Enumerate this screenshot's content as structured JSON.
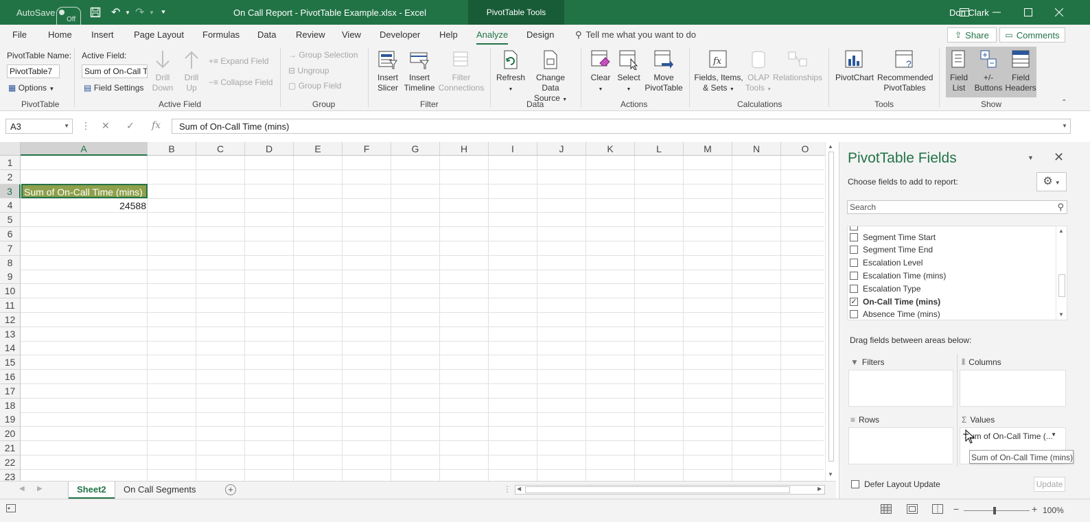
{
  "titlebar": {
    "autosave_label": "AutoSave",
    "autosave_state": "Off",
    "title": "On Call Report - PivotTable Example.xlsx  -  Excel",
    "context_tab": "PivotTable Tools",
    "user": "Don Clark",
    "accent_color": "#217346"
  },
  "menu": {
    "items": [
      "File",
      "Home",
      "Insert",
      "Page Layout",
      "Formulas",
      "Data",
      "Review",
      "View",
      "Developer",
      "Help",
      "Analyze",
      "Design"
    ],
    "active": "Analyze",
    "tell_me": "Tell me what you want to do",
    "share": "Share",
    "comments": "Comments"
  },
  "ribbon": {
    "pivottable": {
      "name_label": "PivotTable Name:",
      "name_value": "PivotTable7",
      "options": "Options",
      "group": "PivotTable"
    },
    "active_field": {
      "label": "Active Field:",
      "value": "Sum of On-Call T",
      "settings": "Field Settings",
      "drill_down_1": "Drill",
      "drill_down_2": "Down",
      "drill_up_1": "Drill",
      "drill_up_2": "Up",
      "expand": "Expand Field",
      "collapse": "Collapse Field",
      "group": "Active Field"
    },
    "group": {
      "selection": "Group Selection",
      "ungroup": "Ungroup",
      "field": "Group Field",
      "group": "Group"
    },
    "filter": {
      "slicer_1": "Insert",
      "slicer_2": "Slicer",
      "timeline_1": "Insert",
      "timeline_2": "Timeline",
      "connections_1": "Filter",
      "connections_2": "Connections",
      "group": "Filter"
    },
    "data": {
      "refresh": "Refresh",
      "change_1": "Change Data",
      "change_2": "Source",
      "group": "Data"
    },
    "actions": {
      "clear": "Clear",
      "select": "Select",
      "move_1": "Move",
      "move_2": "PivotTable",
      "group": "Actions"
    },
    "calculations": {
      "fields_1": "Fields, Items,",
      "fields_2": "& Sets",
      "olap_1": "OLAP",
      "olap_2": "Tools",
      "relationships": "Relationships",
      "group": "Calculations"
    },
    "tools": {
      "pivotchart": "PivotChart",
      "recommended_1": "Recommended",
      "recommended_2": "PivotTables",
      "group": "Tools"
    },
    "show": {
      "fieldlist_1": "Field",
      "fieldlist_2": "List",
      "buttons_1": "+/-",
      "buttons_2": "Buttons",
      "headers_1": "Field",
      "headers_2": "Headers",
      "group": "Show"
    }
  },
  "formula_bar": {
    "name_box": "A3",
    "formula": "Sum of On-Call Time (mins)"
  },
  "grid": {
    "columns": [
      "A",
      "B",
      "C",
      "D",
      "E",
      "F",
      "G",
      "H",
      "I",
      "J",
      "K",
      "L",
      "M",
      "N",
      "O"
    ],
    "rows": [
      "1",
      "2",
      "3",
      "4",
      "5",
      "6",
      "7",
      "8",
      "9",
      "10",
      "11",
      "12",
      "13",
      "14",
      "15",
      "16",
      "17",
      "18",
      "19",
      "20",
      "21",
      "22",
      "23"
    ],
    "a3": "Sum of On-Call Time (mins)",
    "a4": "24588"
  },
  "sheets": {
    "tabs": [
      "Sheet2",
      "On Call Segments"
    ],
    "active": "Sheet2"
  },
  "status": {
    "zoom": "100%"
  },
  "pivot_panel": {
    "title": "PivotTable Fields",
    "subtitle": "Choose fields to add to report:",
    "search_placeholder": "Search",
    "fields": [
      {
        "label": "Segment Time Start",
        "checked": false
      },
      {
        "label": "Segment Time End",
        "checked": false
      },
      {
        "label": "Escalation Level",
        "checked": false
      },
      {
        "label": "Escalation Time (mins)",
        "checked": false
      },
      {
        "label": "Escalation Type",
        "checked": false
      },
      {
        "label": "On-Call Time (mins)",
        "checked": true
      },
      {
        "label": "Absence Time (mins)",
        "checked": false
      }
    ],
    "drag_hint": "Drag fields between areas below:",
    "areas": {
      "filters": "Filters",
      "columns": "Columns",
      "rows": "Rows",
      "values": "Values"
    },
    "value_item": "Sum of On-Call Time (...",
    "tooltip": "Sum of On-Call Time (mins)",
    "defer": "Defer Layout Update",
    "update": "Update"
  }
}
